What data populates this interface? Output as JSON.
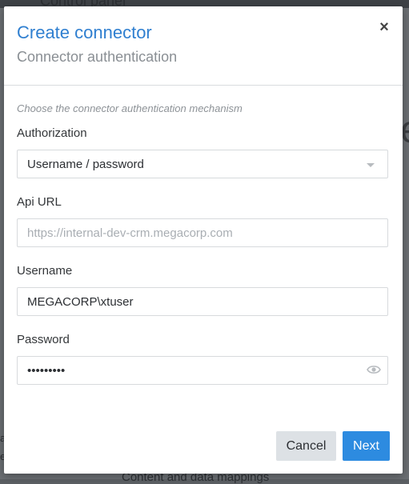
{
  "background": {
    "app_title": "Control panel",
    "footer_text": "Content and data mappings"
  },
  "modal": {
    "title": "Create connector",
    "subtitle": "Connector authentication",
    "close_symbol": "×",
    "hint": "Choose the connector authentication mechanism",
    "authorization": {
      "label": "Authorization",
      "value": "Username / password"
    },
    "api_url": {
      "label": "Api URL",
      "value": "",
      "placeholder": "https://internal-dev-crm.megacorp.com"
    },
    "username": {
      "label": "Username",
      "value": "MEGACORP\\xtuser"
    },
    "password": {
      "label": "Password",
      "value": "•••••••••"
    },
    "buttons": {
      "cancel": "Cancel",
      "next": "Next"
    }
  },
  "colors": {
    "accent": "#2d8be0",
    "title": "#2f7fd0"
  }
}
